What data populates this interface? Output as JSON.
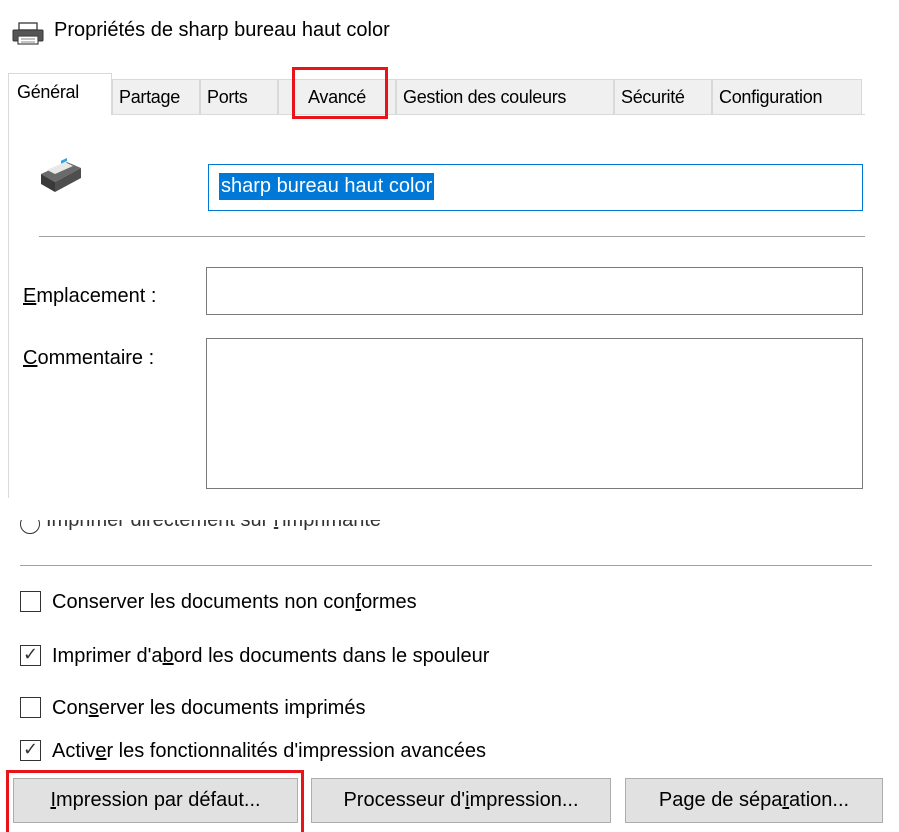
{
  "window": {
    "title": "Propriétés de sharp bureau haut color",
    "icon": "printer-icon"
  },
  "tabs": [
    {
      "label": "Général",
      "active": true
    },
    {
      "label": "Partage",
      "active": false
    },
    {
      "label": "Ports",
      "active": false
    },
    {
      "label": "Avancé",
      "active": false,
      "highlighted": true
    },
    {
      "label": "Gestion des couleurs",
      "active": false
    },
    {
      "label": "Sécurité",
      "active": false
    },
    {
      "label": "Configuration",
      "active": false
    }
  ],
  "general": {
    "printer_name": "sharp bureau haut color",
    "location": {
      "accel": "E",
      "rest": "mplacement :",
      "value": ""
    },
    "comment": {
      "accel": "C",
      "rest": "ommentaire :",
      "value": ""
    }
  },
  "advanced": {
    "cut_radio": {
      "pre": "Imprimer directement sur ",
      "accel": "l",
      "post": "'imprimante"
    },
    "options": [
      {
        "pre": "Conserver les documents non con",
        "accel": "f",
        "post": "ormes",
        "checked": false
      },
      {
        "pre": "Imprimer d'a",
        "accel": "b",
        "post": "ord les documents dans le spouleur",
        "checked": true
      },
      {
        "pre": "Con",
        "accel": "s",
        "post": "erver les documents imprimés",
        "checked": false
      },
      {
        "pre": "Activ",
        "accel": "e",
        "post": "r les fonctionnalités d'impression avancées",
        "checked": true
      }
    ],
    "buttons": [
      {
        "pre": "",
        "accel": "I",
        "post": "mpression par défaut...",
        "highlighted": true
      },
      {
        "pre": "Processeur d'",
        "accel": "i",
        "post": "mpression...",
        "highlighted": false
      },
      {
        "pre": "Page de sépa",
        "accel": "r",
        "post": "ation...",
        "highlighted": false
      }
    ]
  },
  "colors": {
    "highlight": "#e8141a",
    "selection": "#0078d7"
  }
}
